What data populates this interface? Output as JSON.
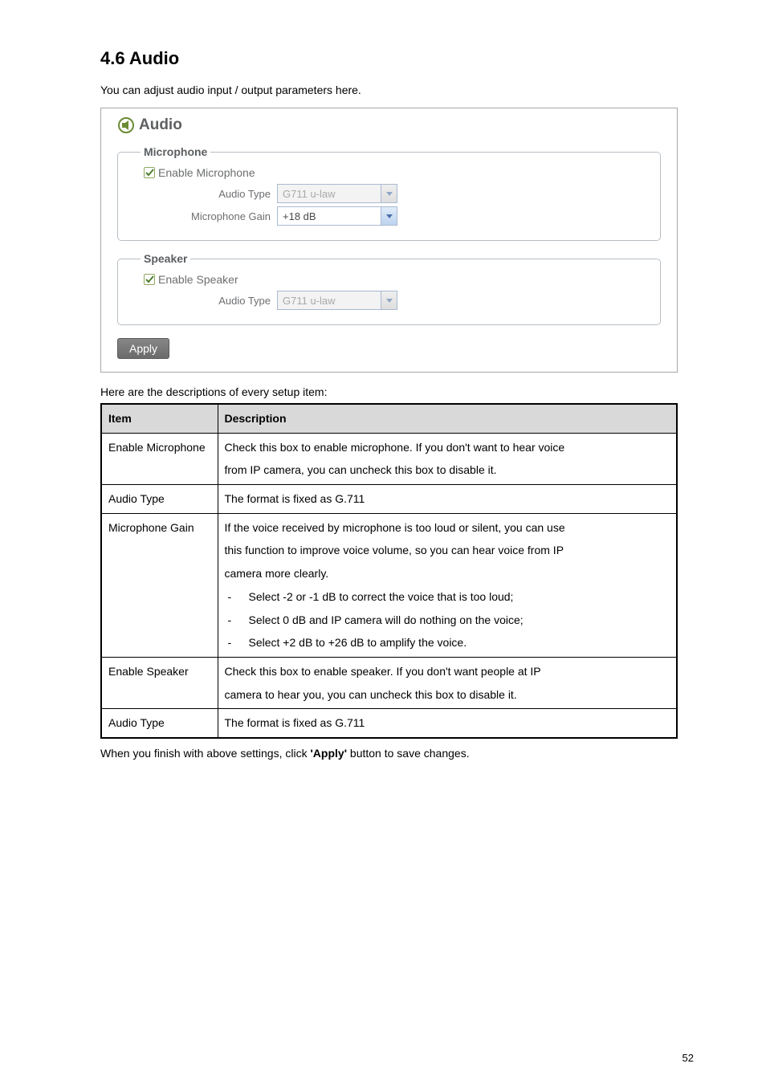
{
  "heading": "4.6 Audio",
  "intro": "You can adjust audio input / output parameters here.",
  "panel": {
    "title": "Audio",
    "microphone": {
      "legend": "Microphone",
      "enable_label": "Enable Microphone",
      "audio_type_label": "Audio Type",
      "audio_type_value": "G711 u-law",
      "gain_label": "Microphone Gain",
      "gain_value": "+18 dB"
    },
    "speaker": {
      "legend": "Speaker",
      "enable_label": "Enable Speaker",
      "audio_type_label": "Audio Type",
      "audio_type_value": "G711 u-law"
    },
    "apply_label": "Apply"
  },
  "table_intro": "Here are the descriptions of every setup item:",
  "table": {
    "head_item": "Item",
    "head_desc": "Description",
    "rows": [
      {
        "item": "Enable Microphone",
        "desc_lines": [
          "Check this box to enable microphone. If you don't want to hear voice",
          "from IP camera, you can uncheck this box to disable it."
        ]
      },
      {
        "item": "Audio Type",
        "desc_lines": [
          "The format is fixed as G.711"
        ]
      },
      {
        "item": "Microphone Gain",
        "desc_lines": [
          "If the voice received by microphone is too loud or silent, you can use",
          "this function to improve voice volume, so you can hear voice from IP",
          "camera more clearly."
        ],
        "bullets": [
          "Select -2 or -1 dB to correct the voice that is too loud;",
          "Select 0 dB and IP camera will do nothing on the voice;",
          "Select +2 dB to +26 dB to amplify the voice."
        ]
      },
      {
        "item": "Enable Speaker",
        "desc_lines": [
          "Check this box to enable speaker. If you don't want people at IP",
          "camera to hear you, you can uncheck this box to disable it."
        ]
      },
      {
        "item": "Audio Type",
        "desc_lines": [
          "The format is fixed as G.711"
        ]
      }
    ]
  },
  "closing_pre": "When you finish with above settings, click ",
  "closing_bold": "'Apply'",
  "closing_post": " button to save changes.",
  "page_number": "52"
}
